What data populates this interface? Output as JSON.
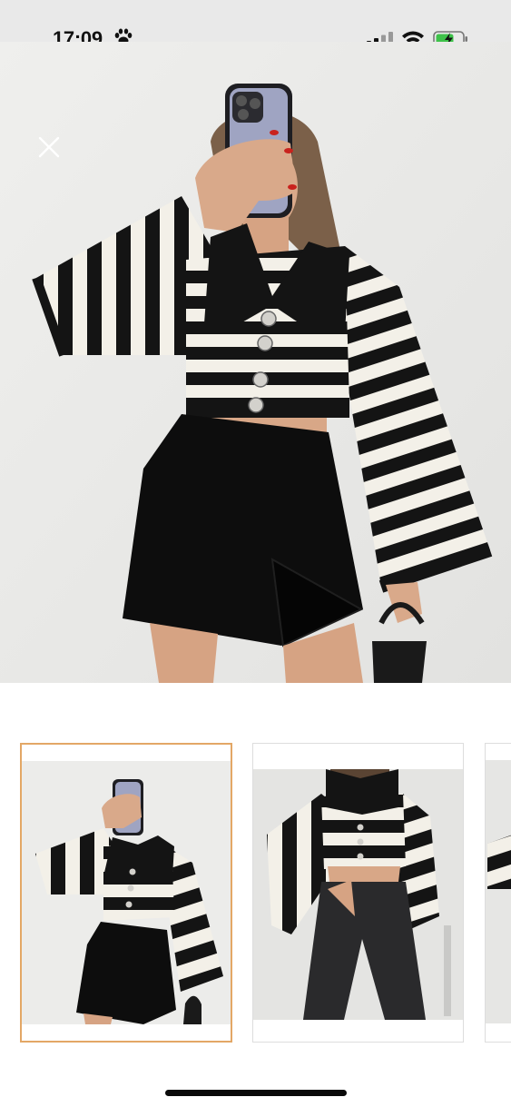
{
  "status_bar": {
    "time": "17:09",
    "icons": [
      "paw-icon",
      "cellular-signal-icon",
      "wifi-icon",
      "battery-charging-icon"
    ],
    "battery_color": "#3ec24a"
  },
  "viewer": {
    "close_icon": "close-icon",
    "main_image": "striped-knit-cardigan-with-black-skort",
    "selected_thumbnail_index": 0,
    "accent_color": "#e3a766"
  },
  "thumbnails": [
    {
      "image": "striped-cardigan-with-skort",
      "selected": true
    },
    {
      "image": "striped-cardigan-with-leather-pants",
      "selected": false
    },
    {
      "image": "striped-cardigan-partial",
      "selected": false
    }
  ]
}
